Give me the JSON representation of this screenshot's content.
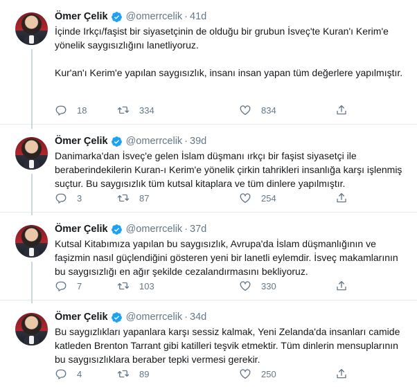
{
  "accent_color": "#1da1f2",
  "tweets": [
    {
      "name": "Ömer Çelik",
      "handle": "@omerrcelik",
      "separator": "·",
      "time": "41d",
      "paragraphs": [
        "İçinde Irkçı/faşist bir siyasetçinin de olduğu bir grubun İsveç'te Kuran'ı Kerim'e yönelik saygısızlığını lanetliyoruz.",
        "Kur'an'ı Kerim'e yapılan saygısızlık, insanı insan yapan tüm değerlere yapılmıştır."
      ],
      "replies": "18",
      "retweets": "334",
      "likes": "834"
    },
    {
      "name": "Ömer Çelik",
      "handle": "@omerrcelik",
      "separator": "·",
      "time": "39d",
      "paragraphs": [
        "Danimarka'dan İsveç'e gelen İslam düşmanı ırkçı bir faşist siyasetçi ile beraberindekilerin Kuran-ı Kerim'e yönelik çirkin tahrikleri insanlığa karşı işlenmiş suçtur. Bu saygısızlık tüm kutsal kitaplara ve tüm dinlere yapılmıştır."
      ],
      "replies": "3",
      "retweets": "87",
      "likes": "254"
    },
    {
      "name": "Ömer Çelik",
      "handle": "@omerrcelik",
      "separator": "·",
      "time": "37d",
      "paragraphs": [
        "Kutsal Kitabımıza yapılan bu saygısızlık, Avrupa'da İslam düşmanlığının ve faşizmin nasıl güçlendiğini gösteren yeni bir lanetli eylemdir. İsveç makamlarının bu saygısızlığı en ağır şekilde cezalandırmasını bekliyoruz."
      ],
      "replies": "7",
      "retweets": "103",
      "likes": "330"
    },
    {
      "name": "Ömer Çelik",
      "handle": "@omerrcelik",
      "separator": "·",
      "time": "34d",
      "paragraphs": [
        "Bu saygızlıkları yapanlara karşı sessiz kalmak, Yeni Zelanda'da insanları camide katleden Brenton Tarrant gibi katilleri teşvik etmektir. Tüm dinlerin mensuplarının bu saygısızlıklara beraber tepki vermesi gerekir."
      ],
      "replies": "4",
      "retweets": "89",
      "likes": "250"
    }
  ]
}
